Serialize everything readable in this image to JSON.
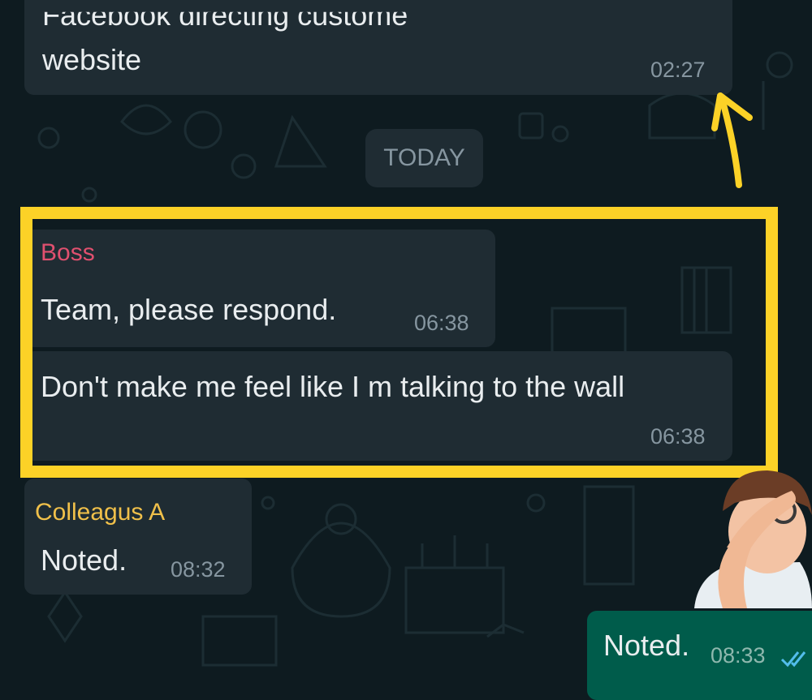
{
  "messages": [
    {
      "id": "prev",
      "text_line1": "Facebook directing custome",
      "text_line2": "website",
      "time": "02:27"
    },
    {
      "id": "boss1",
      "sender": "Boss",
      "text": "Team, please respond.",
      "time": "06:38"
    },
    {
      "id": "boss2",
      "text": "Don't make me feel like I m talking to the wall",
      "time": "06:38"
    },
    {
      "id": "colleague",
      "sender": "Colleagus A",
      "text": "Noted.",
      "time": "08:32"
    },
    {
      "id": "mine",
      "text": "Noted.",
      "time": "08:33",
      "status_icon": "double-check-icon"
    }
  ],
  "date_separator": "TODAY",
  "colors": {
    "background": "#0e1b20",
    "incoming_bubble": "#1f2c33",
    "outgoing_bubble": "#005c4b",
    "highlight": "#fcd227",
    "boss_name": "#e0506f",
    "colleague_name": "#f0c04a",
    "read_ticks": "#53bdeb"
  },
  "annotations": {
    "arrow_icon": "arrow-up-icon",
    "highlight": "highlight-box"
  },
  "sticker": {
    "icon": "facepalm-sticker-icon"
  }
}
